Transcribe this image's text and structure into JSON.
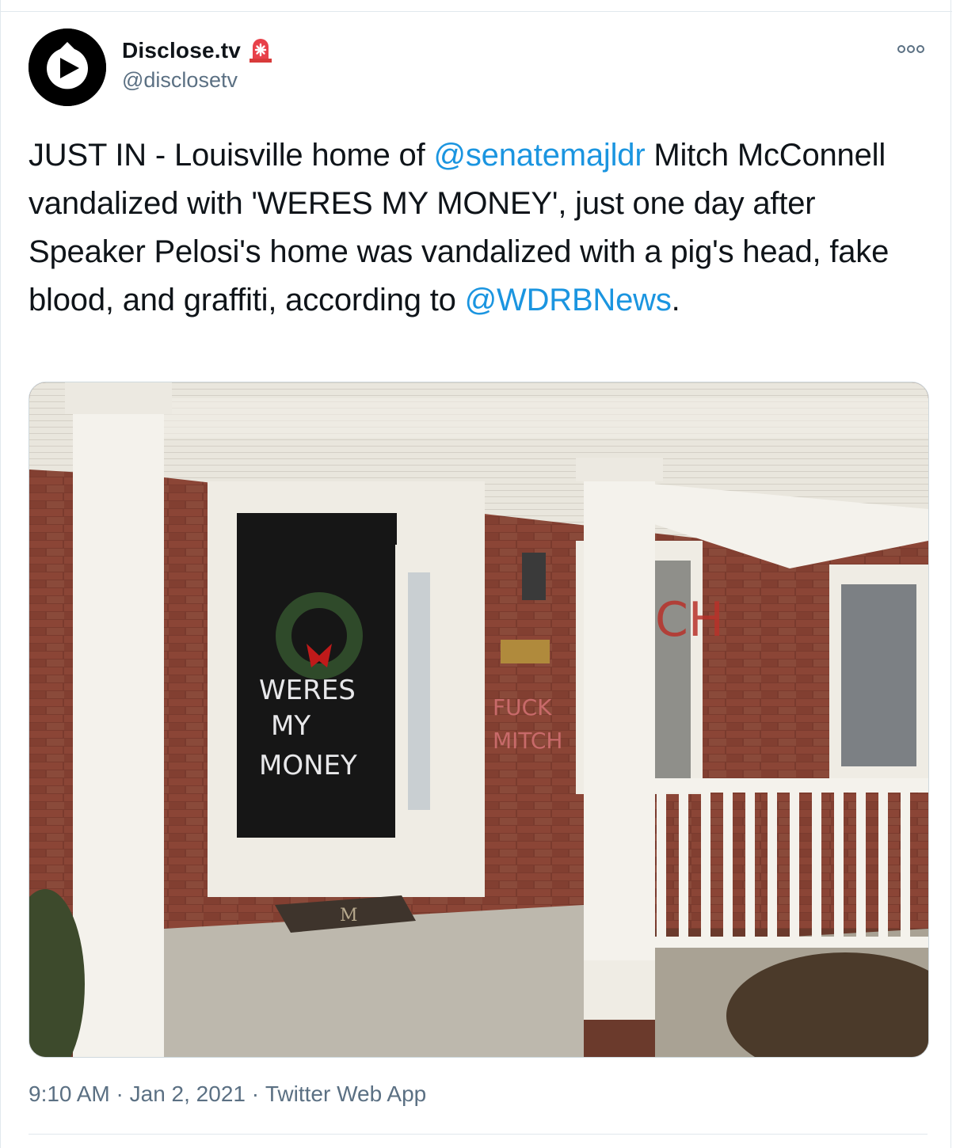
{
  "tweet": {
    "author": {
      "display_name": "Disclose.tv",
      "handle": "@disclosetv",
      "badge_icon": "siren-icon",
      "avatar_icon": "play-logo-icon"
    },
    "text": {
      "part1": "JUST IN - Louisville home of ",
      "mention1": "@senatemajldr",
      "part2": " Mitch McConnell vandalized with 'WERES MY MONEY', just one day after Speaker Pelosi's home was vandalized with a pig's head, fake blood, and graffiti, according to ",
      "mention2": "@WDRBNews",
      "part3": "."
    },
    "media": {
      "door_graffiti": [
        "WERES",
        "MY",
        "MONEY"
      ],
      "wall_graffiti": [
        "FUCK",
        "MITCH"
      ],
      "doormat_letter": "M"
    },
    "meta": {
      "time": "9:10 AM",
      "separator": " · ",
      "date": "Jan 2, 2021",
      "source": "Twitter Web App"
    }
  },
  "colors": {
    "link": "#1b95e0",
    "secondary_text": "#5b7083",
    "border": "#e1e8ed"
  }
}
